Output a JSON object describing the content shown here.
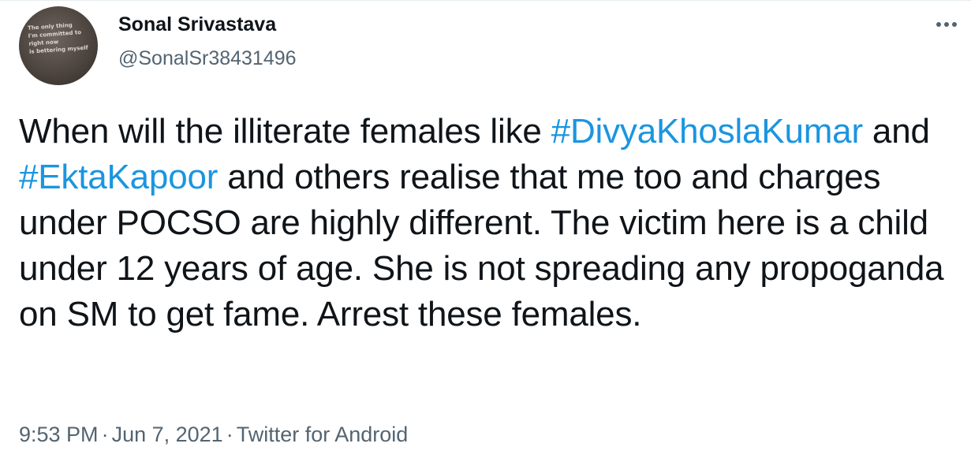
{
  "author": {
    "name": "Sonal Srivastava",
    "handle": "@SonalSr38431496",
    "avatar_text": "The only thing\nI'm committed to\nright now\nis bettering myself"
  },
  "tweet": {
    "text_before_1": "When will the illiterate females like ",
    "hashtag_1": "#DivyaKhoslaKumar",
    "text_between": " and ",
    "hashtag_2": "#EktaKapoor",
    "text_after": " and others realise that me too and charges under POCSO are highly different. The victim here is a child under 12 years of age. She is not spreading any propoganda on SM to get fame. Arrest these females."
  },
  "meta": {
    "time": "9:53 PM",
    "separator": "·",
    "date": "Jun 7, 2021",
    "source": "Twitter for Android"
  },
  "colors": {
    "text": "#0f1419",
    "secondary": "#536471",
    "link": "#1b95e0"
  },
  "icons": {
    "more": "more-horizontal-icon"
  }
}
